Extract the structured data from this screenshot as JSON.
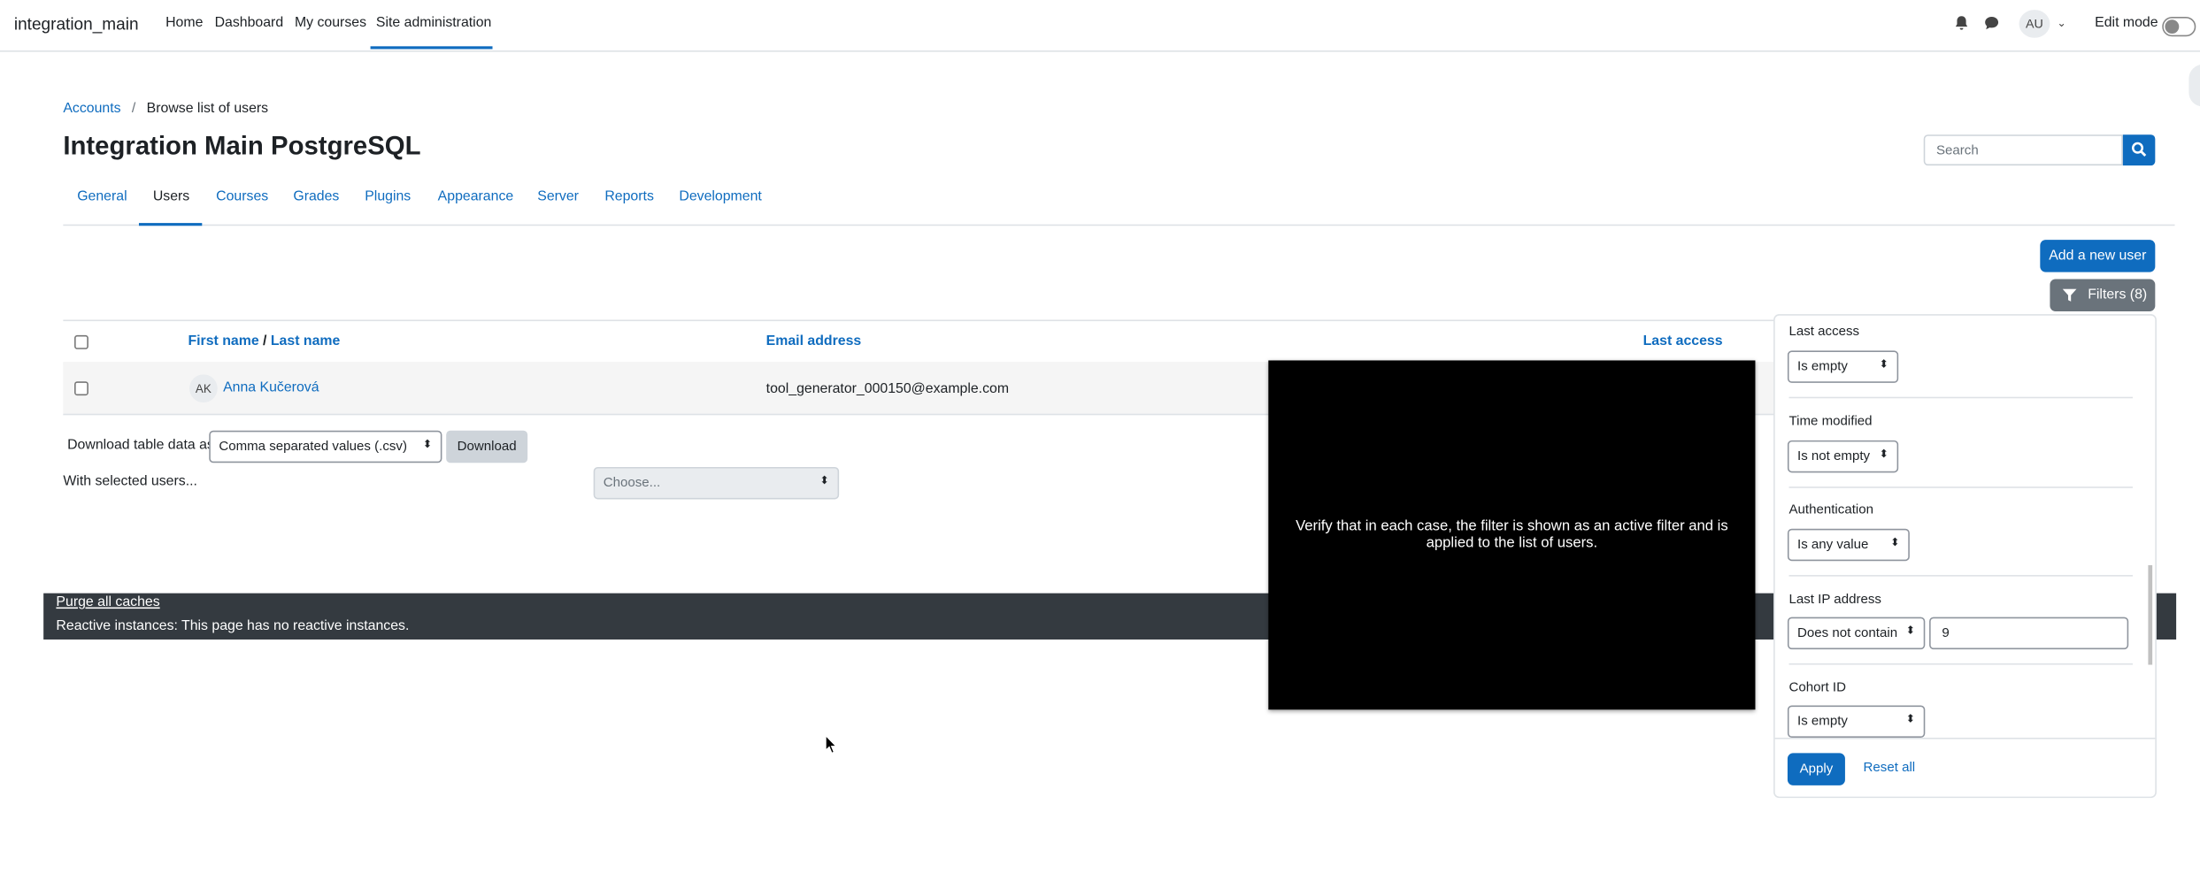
{
  "nav": {
    "brand": "integration_main",
    "items": [
      "Home",
      "Dashboard",
      "My courses",
      "Site administration"
    ],
    "avatar_initials": "AU",
    "edit_mode_label": "Edit mode"
  },
  "breadcrumb": {
    "parent": "Accounts",
    "separator": "/",
    "current": "Browse list of users"
  },
  "page": {
    "title": "Integration Main PostgreSQL"
  },
  "search": {
    "placeholder": "Search"
  },
  "tabs": [
    "General",
    "Users",
    "Courses",
    "Grades",
    "Plugins",
    "Appearance",
    "Server",
    "Reports",
    "Development"
  ],
  "actions": {
    "add_user": "Add a new user",
    "filters": "Filters (8)"
  },
  "table": {
    "headers": {
      "first_name": "First name",
      "name_separator": "/",
      "last_name": "Last name",
      "email": "Email address",
      "last_access": "Last access"
    },
    "rows": [
      {
        "initials": "AK",
        "name": "Anna Kučerová",
        "email": "tool_generator_000150@example.com"
      }
    ]
  },
  "download": {
    "label": "Download table data as",
    "format": "Comma separated values (.csv)",
    "button": "Download"
  },
  "bulk": {
    "label": "With selected users...",
    "placeholder": "Choose..."
  },
  "footer": {
    "purge": "Purge all caches",
    "reactive": "Reactive instances: This page has no reactive instances."
  },
  "overlay": {
    "text": "Verify that in each case, the filter is shown as an active filter and is applied to the list of users."
  },
  "filters": [
    {
      "label": "Last access",
      "operator": "Is empty"
    },
    {
      "label": "Time modified",
      "operator": "Is not empty"
    },
    {
      "label": "Authentication",
      "operator": "Is any value"
    },
    {
      "label": "Last IP address",
      "operator": "Does not contain",
      "value": "9"
    },
    {
      "label": "Cohort ID",
      "operator": "Is empty"
    }
  ],
  "filter_actions": {
    "apply": "Apply",
    "reset": "Reset all"
  },
  "colors": {
    "primary": "#0f6cbf",
    "footer": "#343a40",
    "overlay": "#000000"
  }
}
